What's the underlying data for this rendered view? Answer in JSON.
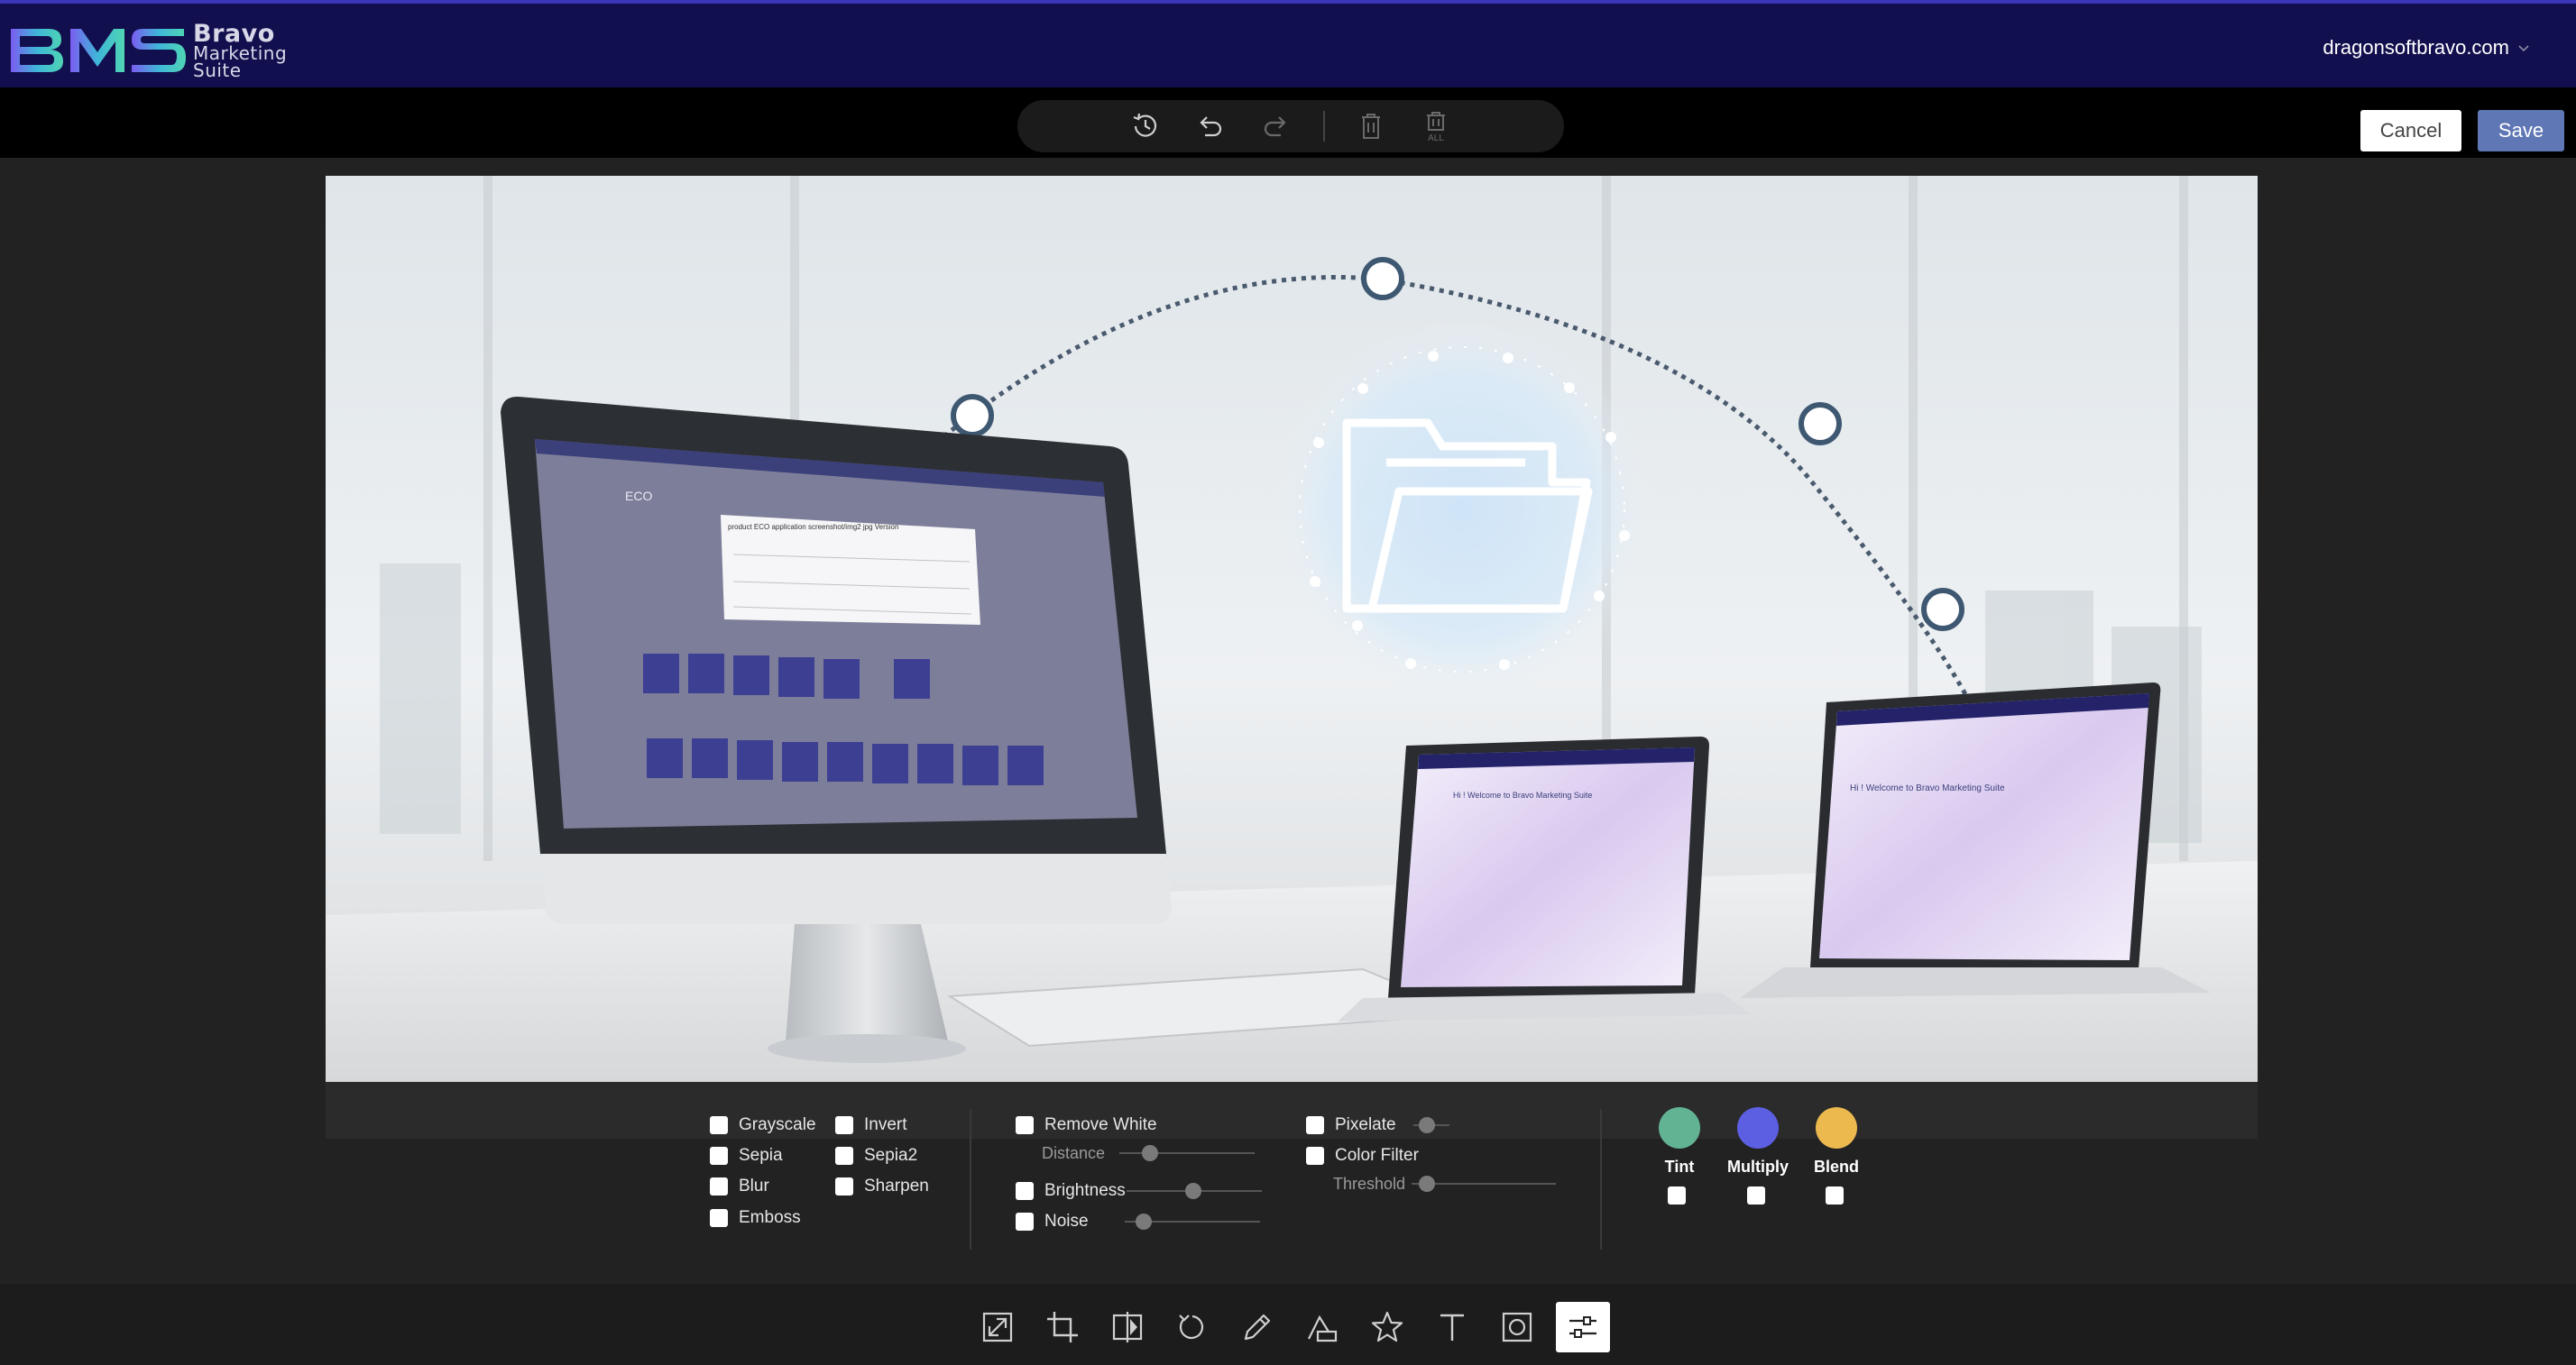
{
  "header": {
    "logo_line1": "Bravo",
    "logo_line2": "Marketing",
    "logo_line3": "Suite",
    "user_email": "dragonsoftbravo.com"
  },
  "history_toolbar": {
    "buttons": [
      "history-icon",
      "undo-icon",
      "redo-icon",
      "delete-icon",
      "delete-all-icon"
    ],
    "delete_all_label": "ALL"
  },
  "actions": {
    "cancel_label": "Cancel",
    "save_label": "Save"
  },
  "canvas": {
    "small_screen_heading": "ECO",
    "dialog_title": "product ECO application screenshot/img2 jpg Version",
    "laptop_welcome": "Hi ! Welcome to Bravo Marketing Suite",
    "laptop2_welcome": "Hi ! Welcome to Bravo Marketing Suite"
  },
  "filters": {
    "col1": [
      "Grayscale",
      "Sepia",
      "Blur",
      "Emboss"
    ],
    "col2": [
      "Invert",
      "Sepia2",
      "Sharpen"
    ],
    "remove_white": "Remove White",
    "distance": "Distance",
    "brightness": "Brightness",
    "noise": "Noise",
    "pixelate": "Pixelate",
    "color_filter": "Color Filter",
    "threshold": "Threshold",
    "blend_modes": [
      {
        "label": "Tint",
        "color": "#62b394"
      },
      {
        "label": "Multiply",
        "color": "#5d5fe3"
      },
      {
        "label": "Blend",
        "color": "#ecb94f"
      }
    ]
  },
  "bottom_tools": {
    "items": [
      "resize-icon",
      "crop-icon",
      "flip-icon",
      "rotate-icon",
      "draw-icon",
      "shape-icon",
      "icon-icon",
      "text-icon",
      "mask-icon",
      "filter-icon"
    ],
    "active": "filter-icon"
  }
}
